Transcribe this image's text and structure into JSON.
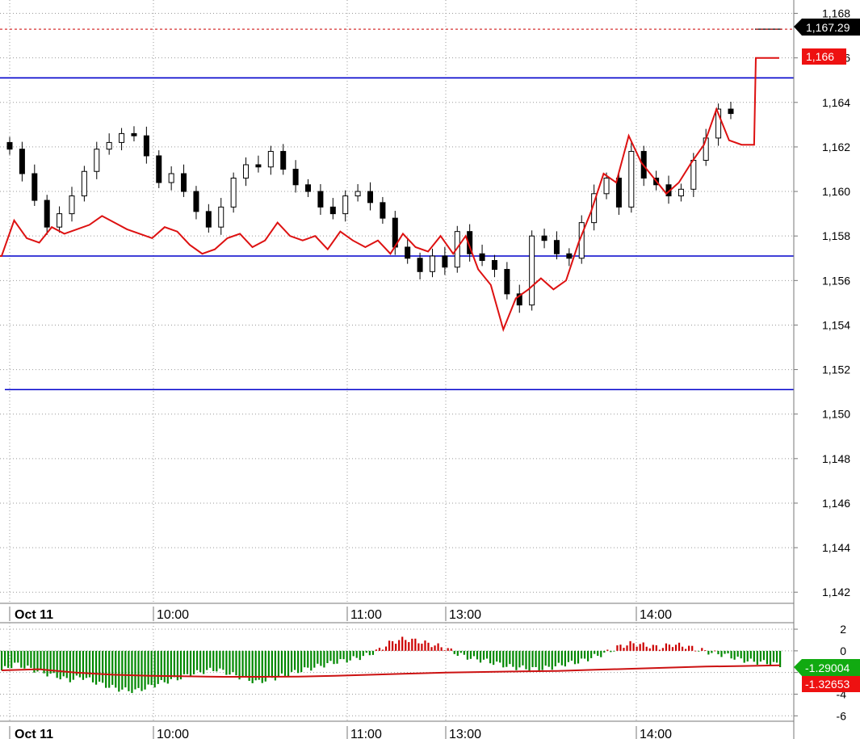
{
  "chart_data": [
    {
      "type": "candlestick",
      "title": "",
      "date_label": "Oct 11",
      "x_ticks": [
        "10:00",
        "11:00",
        "13:00",
        "14:00"
      ],
      "y_ticks": [
        "1,168",
        "1,166",
        "1,164",
        "1,162",
        "1,160",
        "1,158",
        "1,156",
        "1,154",
        "1,152",
        "1,150",
        "1,148",
        "1,146",
        "1,144",
        "1,142"
      ],
      "ylim": [
        1141.5,
        1168.6
      ],
      "grid": true,
      "current_price_label": "1,167.29",
      "red_line_label": "1,166",
      "current_price": 1167.29,
      "horizontal_lines": [
        {
          "value": 1165.1,
          "color": "#0000cc"
        },
        {
          "value": 1157.1,
          "color": "#0000cc"
        },
        {
          "value": 1151.1,
          "color": "#0000cc"
        }
      ],
      "candles_close_approx": [
        1161.9,
        1160.8,
        1159.6,
        1158.4,
        1159.0,
        1159.8,
        1160.9,
        1161.9,
        1162.2,
        1162.6,
        1162.5,
        1161.6,
        1160.4,
        1160.8,
        1160.0,
        1159.1,
        1158.4,
        1159.3,
        1160.6,
        1161.2,
        1161.1,
        1161.8,
        1161.0,
        1160.3,
        1160.0,
        1159.3,
        1159.0,
        1159.8,
        1160.0,
        1159.5,
        1158.8,
        1157.5,
        1157.0,
        1156.4,
        1157.1,
        1156.6,
        1158.2,
        1157.2,
        1156.9,
        1156.5,
        1155.4,
        1154.9,
        1158.0,
        1157.8,
        1157.2,
        1157.0,
        1158.6,
        1159.9,
        1160.6,
        1159.3,
        1161.8,
        1160.6,
        1160.3,
        1159.8,
        1160.1,
        1161.4,
        1162.4,
        1163.7,
        1163.5
      ],
      "red_series_values": [
        1157.1,
        1158.7,
        1157.9,
        1157.7,
        1158.4,
        1158.1,
        1158.3,
        1158.5,
        1158.9,
        1158.6,
        1158.3,
        1158.1,
        1157.9,
        1158.4,
        1158.2,
        1157.6,
        1157.2,
        1157.4,
        1157.9,
        1158.1,
        1157.5,
        1157.8,
        1158.6,
        1158.0,
        1157.8,
        1158.0,
        1157.4,
        1158.2,
        1157.8,
        1157.5,
        1157.8,
        1157.2,
        1158.1,
        1157.5,
        1157.3,
        1158.0,
        1157.2,
        1158.0,
        1156.5,
        1155.8,
        1153.8,
        1155.2,
        1155.6,
        1156.1,
        1155.6,
        1156.0,
        1157.7,
        1159.1,
        1160.8,
        1160.4,
        1162.5,
        1161.3,
        1160.6,
        1159.9,
        1160.4,
        1161.3,
        1162.1,
        1163.7,
        1162.3,
        1162.1,
        1162.1,
        1166.0,
        1166.0
      ]
    },
    {
      "type": "histogram",
      "title": "",
      "date_label": "Oct 11",
      "x_ticks": [
        "10:00",
        "11:00",
        "13:00",
        "14:00"
      ],
      "y_ticks": [
        "2",
        "0",
        "-2",
        "-4",
        "-6"
      ],
      "ylim": [
        -6.5,
        2.6
      ],
      "grid": true,
      "histogram_label": "-1.29004",
      "signal_label": "-1.32653",
      "histogram_last": -1.29004,
      "signal_last": -1.32653,
      "histogram_values_approx": [
        -1.8,
        -1.2,
        -1.6,
        -2.0,
        -2.3,
        -2.7,
        -2.4,
        -2.9,
        -3.3,
        -3.6,
        -3.7,
        -3.3,
        -2.9,
        -2.6,
        -2.2,
        -1.9,
        -1.7,
        -2.1,
        -2.5,
        -2.9,
        -2.6,
        -2.3,
        -1.9,
        -1.6,
        -1.3,
        -1.0,
        -0.8,
        -0.5,
        0.0,
        0.8,
        1.1,
        0.9,
        0.6,
        0.3,
        -0.3,
        -0.7,
        -0.9,
        -1.2,
        -1.5,
        -1.6,
        -1.7,
        -1.5,
        -1.2,
        -1.0,
        -0.6,
        -0.2,
        0.4,
        0.7,
        0.5,
        0.3,
        0.6,
        0.4,
        0.1,
        -0.2,
        -0.4,
        -0.8,
        -1.0,
        -1.1,
        -1.29
      ],
      "signal_values_approx": [
        -1.8,
        -1.7,
        -2.0,
        -2.2,
        -2.3,
        -2.35,
        -2.4,
        -2.4,
        -2.38,
        -2.3,
        -2.2,
        -2.1,
        -2.0,
        -1.95,
        -1.9,
        -1.85,
        -1.75,
        -1.65,
        -1.55,
        -1.45,
        -1.4,
        -1.33
      ]
    }
  ],
  "colors": {
    "bull_candle": "#ffffff",
    "bear_candle": "#000000",
    "red_line": "#dd1111",
    "blue_line": "#0000cc",
    "hist_pos": "#cc0000",
    "hist_neg": "#008800",
    "grid": "#999999",
    "price_tag_bg": "#000000",
    "red_tag_bg": "#ee1111",
    "green_tag_bg": "#11aa11"
  }
}
